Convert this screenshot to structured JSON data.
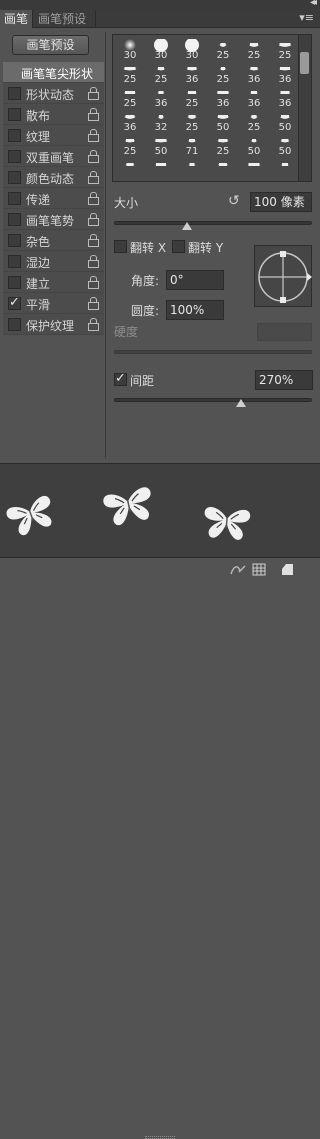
{
  "tabs": {
    "brush": "画笔",
    "presets": "画笔预设"
  },
  "icons": {
    "collapse": "double-chevron-right-icon",
    "menu": "panel-menu-icon"
  },
  "preset_button": "画笔预设",
  "left_list": [
    {
      "label": "画笔笔尖形状",
      "selected": true,
      "checkbox": false,
      "checked": false,
      "lock": false
    },
    {
      "label": "形状动态",
      "checkbox": true,
      "checked": false,
      "lock": true
    },
    {
      "label": "散布",
      "checkbox": true,
      "checked": false,
      "lock": true
    },
    {
      "label": "纹理",
      "checkbox": true,
      "checked": false,
      "lock": true
    },
    {
      "label": "双重画笔",
      "checkbox": true,
      "checked": false,
      "lock": true
    },
    {
      "label": "颜色动态",
      "checkbox": true,
      "checked": false,
      "lock": true
    },
    {
      "label": "传递",
      "checkbox": true,
      "checked": false,
      "lock": true
    },
    {
      "label": "画笔笔势",
      "checkbox": true,
      "checked": false,
      "lock": true
    },
    {
      "label": "杂色",
      "checkbox": true,
      "checked": false,
      "lock": true
    },
    {
      "label": "湿边",
      "checkbox": true,
      "checked": false,
      "lock": true
    },
    {
      "label": "建立",
      "checkbox": true,
      "checked": false,
      "lock": true
    },
    {
      "label": "平滑",
      "checkbox": true,
      "checked": true,
      "lock": true
    },
    {
      "label": "保护纹理",
      "checkbox": true,
      "checked": false,
      "lock": true
    }
  ],
  "brush_tips": [
    [
      "30",
      "30",
      "30",
      "25",
      "25",
      "25"
    ],
    [
      "25",
      "25",
      "36",
      "25",
      "36",
      "36"
    ],
    [
      "25",
      "36",
      "25",
      "36",
      "36",
      "36"
    ],
    [
      "36",
      "32",
      "25",
      "50",
      "25",
      "50"
    ],
    [
      "25",
      "50",
      "71",
      "25",
      "50",
      "50"
    ],
    [
      "",
      "",
      "",
      "",
      "",
      ""
    ]
  ],
  "size": {
    "label": "大小",
    "value": "100 像素",
    "reset_icon": "reset-arrow-icon",
    "level": 0.37
  },
  "flip": {
    "x_label": "翻转 X",
    "y_label": "翻转 Y"
  },
  "angle": {
    "label": "角度:",
    "value": "0°"
  },
  "roundness": {
    "label": "圆度:",
    "value": "100%"
  },
  "hardness": {
    "label": "硬度",
    "level": 0.0
  },
  "spacing": {
    "label": "间距",
    "checked": true,
    "value": "270%",
    "level": 0.64
  },
  "bottom_icons": [
    "toggle-brush-preview-icon",
    "grid-icon",
    "new-preset-icon"
  ]
}
